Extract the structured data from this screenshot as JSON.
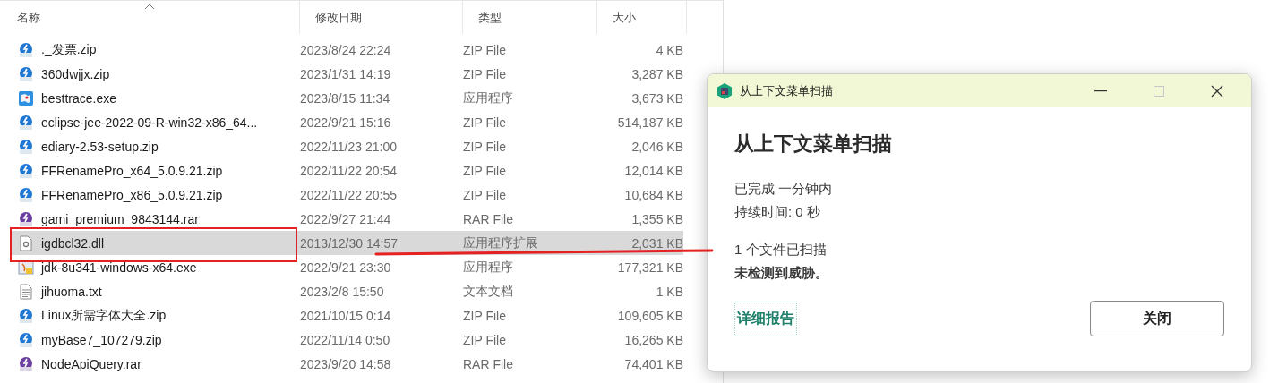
{
  "file_list": {
    "columns": [
      {
        "label": "名称",
        "sorted": true
      },
      {
        "label": "修改日期",
        "sorted": false
      },
      {
        "label": "类型",
        "sorted": false
      },
      {
        "label": "大小",
        "sorted": false
      }
    ],
    "rows": [
      {
        "kind": "zip",
        "name": "._发票.zip",
        "date": "2023/8/24 22:24",
        "type": "ZIP File",
        "size": "4 KB",
        "selected": false
      },
      {
        "kind": "zip",
        "name": "360dwjjx.zip",
        "date": "2023/1/31 14:19",
        "type": "ZIP File",
        "size": "3,287 KB",
        "selected": false
      },
      {
        "kind": "exe",
        "name": "besttrace.exe",
        "date": "2023/8/15 11:34",
        "type": "应用程序",
        "size": "3,673 KB",
        "selected": false
      },
      {
        "kind": "zip",
        "name": "eclipse-jee-2022-09-R-win32-x86_64...",
        "date": "2022/9/21 15:16",
        "type": "ZIP File",
        "size": "514,187 KB",
        "selected": false
      },
      {
        "kind": "zip",
        "name": "ediary-2.53-setup.zip",
        "date": "2022/11/23 21:00",
        "type": "ZIP File",
        "size": "2,046 KB",
        "selected": false
      },
      {
        "kind": "zip",
        "name": "FFRenamePro_x64_5.0.9.21.zip",
        "date": "2022/11/22 20:54",
        "type": "ZIP File",
        "size": "12,014 KB",
        "selected": false
      },
      {
        "kind": "zip",
        "name": "FFRenamePro_x86_5.0.9.21.zip",
        "date": "2022/11/22 20:55",
        "type": "ZIP File",
        "size": "10,684 KB",
        "selected": false
      },
      {
        "kind": "rar",
        "name": "gami_premium_9843144.rar",
        "date": "2022/9/27 21:44",
        "type": "RAR File",
        "size": "1,355 KB",
        "selected": false
      },
      {
        "kind": "dll",
        "name": "igdbcl32.dll",
        "date": "2013/12/30 14:57",
        "type": "应用程序扩展",
        "size": "2,031 KB",
        "selected": true
      },
      {
        "kind": "installer",
        "name": "jdk-8u341-windows-x64.exe",
        "date": "2022/9/21 23:30",
        "type": "应用程序",
        "size": "177,321 KB",
        "selected": false
      },
      {
        "kind": "txt",
        "name": "jihuoma.txt",
        "date": "2023/2/8 15:50",
        "type": "文本文档",
        "size": "1 KB",
        "selected": false
      },
      {
        "kind": "zip",
        "name": "Linux所需字体大全.zip",
        "date": "2021/10/15 0:14",
        "type": "ZIP File",
        "size": "109,605 KB",
        "selected": false
      },
      {
        "kind": "zip",
        "name": "myBase7_107279.zip",
        "date": "2022/11/14 0:50",
        "type": "ZIP File",
        "size": "16,265 KB",
        "selected": false
      },
      {
        "kind": "rar",
        "name": "NodeApiQuery.rar",
        "date": "2023/9/20 14:58",
        "type": "RAR File",
        "size": "74,401 KB",
        "selected": false
      }
    ]
  },
  "dialog": {
    "title": "从上下文菜单扫描",
    "heading": "从上下文菜单扫描",
    "status": "已完成 一分钟内",
    "duration": "持续时间: 0 秒",
    "scanned": "1 个文件已扫描",
    "result": "未检测到威胁。",
    "report_link": "详细报告",
    "close_button": "关闭"
  }
}
